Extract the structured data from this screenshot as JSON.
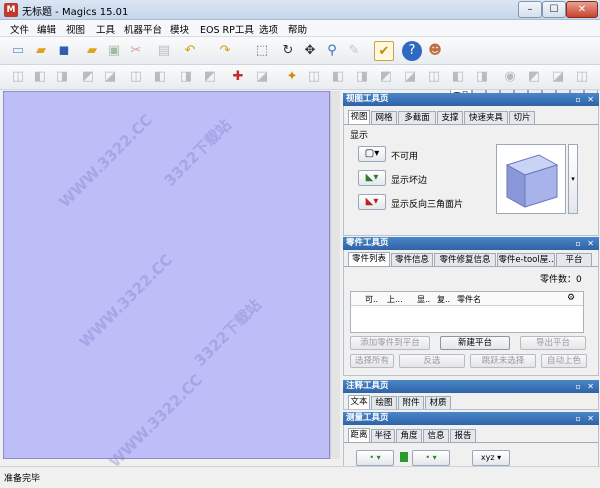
{
  "window": {
    "title": "无标题 - Magics 15.01",
    "app_icon_glyph": "M",
    "minimize": "–",
    "maximize": "☐",
    "close": "✕"
  },
  "menu": [
    "文件",
    "编辑",
    "视图",
    "工具",
    "机器平台",
    "模块",
    "EOS RP工具",
    "选项",
    "帮助"
  ],
  "toolbar": {
    "tool_tab_label": "工具",
    "icons_row1": [
      "new-icon",
      "open-icon",
      "save-icon",
      "open-folder-icon",
      "print-icon",
      "cut-icon",
      "paste-icon",
      "undo-icon",
      "redo-icon",
      "select-icon",
      "rotate-icon",
      "move-icon",
      "zoom-icon",
      "measure-icon",
      "checklist-icon",
      "help-icon",
      "user-help-icon"
    ]
  },
  "viewport": {
    "watermarks": [
      "WWW.3322.CC",
      "3322下载站",
      "WWW.3322.CC",
      "3322下载站",
      "WWW.3322.CC"
    ]
  },
  "view_panel": {
    "title": "视图工具页",
    "tabs": [
      "视图",
      "网格",
      "多截面",
      "支撑",
      "快速夹具",
      "切片"
    ],
    "group_label": "显示",
    "options": [
      {
        "label": "不可用",
        "icon": "cube-outline-icon"
      },
      {
        "label": "显示坏边",
        "icon": "bad-edge-icon"
      },
      {
        "label": "显示反向三角面片",
        "icon": "inverted-triangle-icon"
      }
    ]
  },
  "parts_panel": {
    "title": "零件工具页",
    "tabs": [
      "零件列表",
      "零件信息",
      "零件修复信息",
      "零件e-tool屋..",
      "平台"
    ],
    "count_label": "零件数：0",
    "columns": [
      "可..",
      "上...",
      "显..",
      "复..",
      "零件名"
    ],
    "buttons": [
      {
        "label": "添加零件到平台",
        "enabled": false
      },
      {
        "label": "新建平台",
        "enabled": true
      },
      {
        "label": "导出平台",
        "enabled": false
      },
      {
        "label": "选择所有",
        "enabled": false
      },
      {
        "label": "反选",
        "enabled": false
      },
      {
        "label": "跳跃未选择",
        "enabled": false
      },
      {
        "label": "自动上色",
        "enabled": false
      }
    ]
  },
  "annotation_panel": {
    "title": "注释工具页",
    "tabs": [
      "文本",
      "绘图",
      "附件",
      "材质"
    ]
  },
  "measure_panel": {
    "title": "测量工具页",
    "tabs": [
      "距离",
      "半径",
      "角度",
      "信息",
      "报告"
    ],
    "xyz_label": "xyz"
  },
  "status": {
    "text": "准备完毕"
  },
  "colors": {
    "viewport": "#bdbdf7",
    "panel_header": "#2f63a6"
  }
}
